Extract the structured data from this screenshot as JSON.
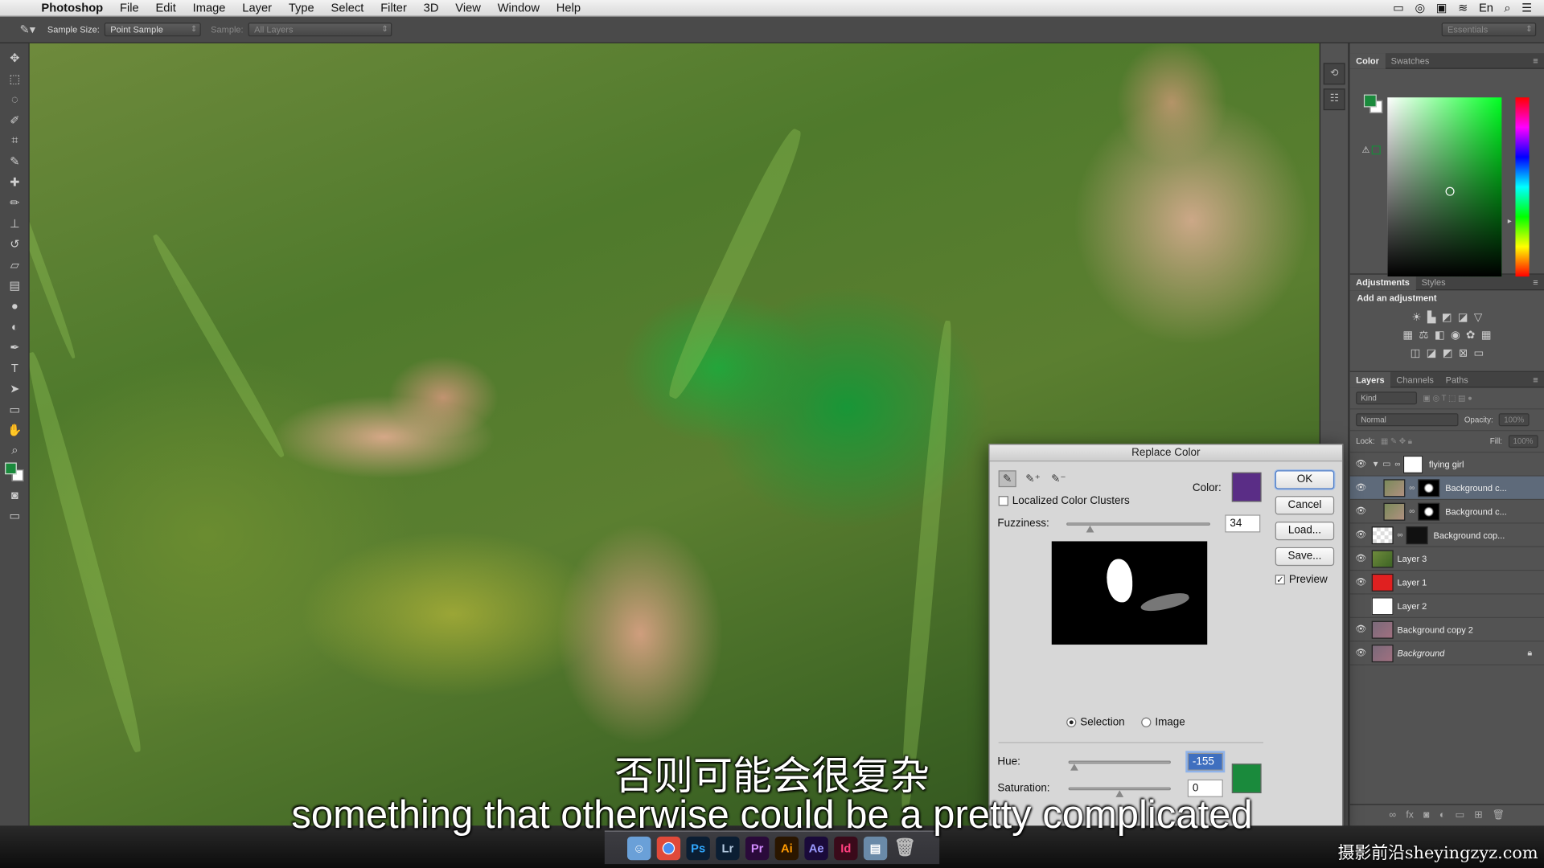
{
  "menubar": {
    "app": "Photoshop",
    "items": [
      "File",
      "Edit",
      "Image",
      "Layer",
      "Type",
      "Select",
      "Filter",
      "3D",
      "View",
      "Window",
      "Help"
    ],
    "input_lang": "En"
  },
  "options": {
    "sample_size_label": "Sample Size:",
    "sample_size_value": "Point Sample",
    "sample_label": "Sample:",
    "sample_value": "All Layers",
    "workspace": "Essentials"
  },
  "panels": {
    "color_tabs": [
      "Color",
      "Swatches"
    ],
    "adjust_tabs": [
      "Adjustments",
      "Styles"
    ],
    "adjust_title": "Add an adjustment",
    "layers_tabs": [
      "Layers",
      "Channels",
      "Paths"
    ],
    "kind": "Kind",
    "blend_mode": "Normal",
    "opacity_label": "Opacity:",
    "opacity_value": "100%",
    "lock_label": "Lock:",
    "fill_label": "Fill:",
    "fill_value": "100%"
  },
  "layers": [
    {
      "name": "flying girl",
      "group": true,
      "visible": true
    },
    {
      "name": "Background c...",
      "visible": true,
      "selected": true
    },
    {
      "name": "Background c...",
      "visible": true
    },
    {
      "name": "Background cop...",
      "visible": true
    },
    {
      "name": "Layer 3",
      "visible": true
    },
    {
      "name": "Layer 1",
      "visible": true,
      "thumb_color": "#e02020"
    },
    {
      "name": "Layer 2",
      "visible": false
    },
    {
      "name": "Background copy 2",
      "visible": true
    },
    {
      "name": "Background",
      "visible": true,
      "locked": true
    }
  ],
  "dialog": {
    "title": "Replace Color",
    "localized_label": "Localized Color Clusters",
    "color_label": "Color:",
    "color_swatch": "#5a2d86",
    "fuzziness_label": "Fuzziness:",
    "fuzziness_value": "34",
    "selection_label": "Selection",
    "image_label": "Image",
    "hue_label": "Hue:",
    "hue_value": "-155",
    "saturation_label": "Saturation:",
    "saturation_value": "0",
    "result_swatch": "#1a8a3c",
    "ok": "OK",
    "cancel": "Cancel",
    "load": "Load...",
    "save": "Save...",
    "preview_label": "Preview"
  },
  "subtitles": {
    "cn": "否则可能会很复杂",
    "en": "something that otherwise could be a pretty complicated"
  },
  "dock_apps": [
    "Ps",
    "Lr",
    "Pr",
    "Ai",
    "Ae",
    "Id"
  ],
  "watermark": "摄影前沿sheyingzyz.com"
}
